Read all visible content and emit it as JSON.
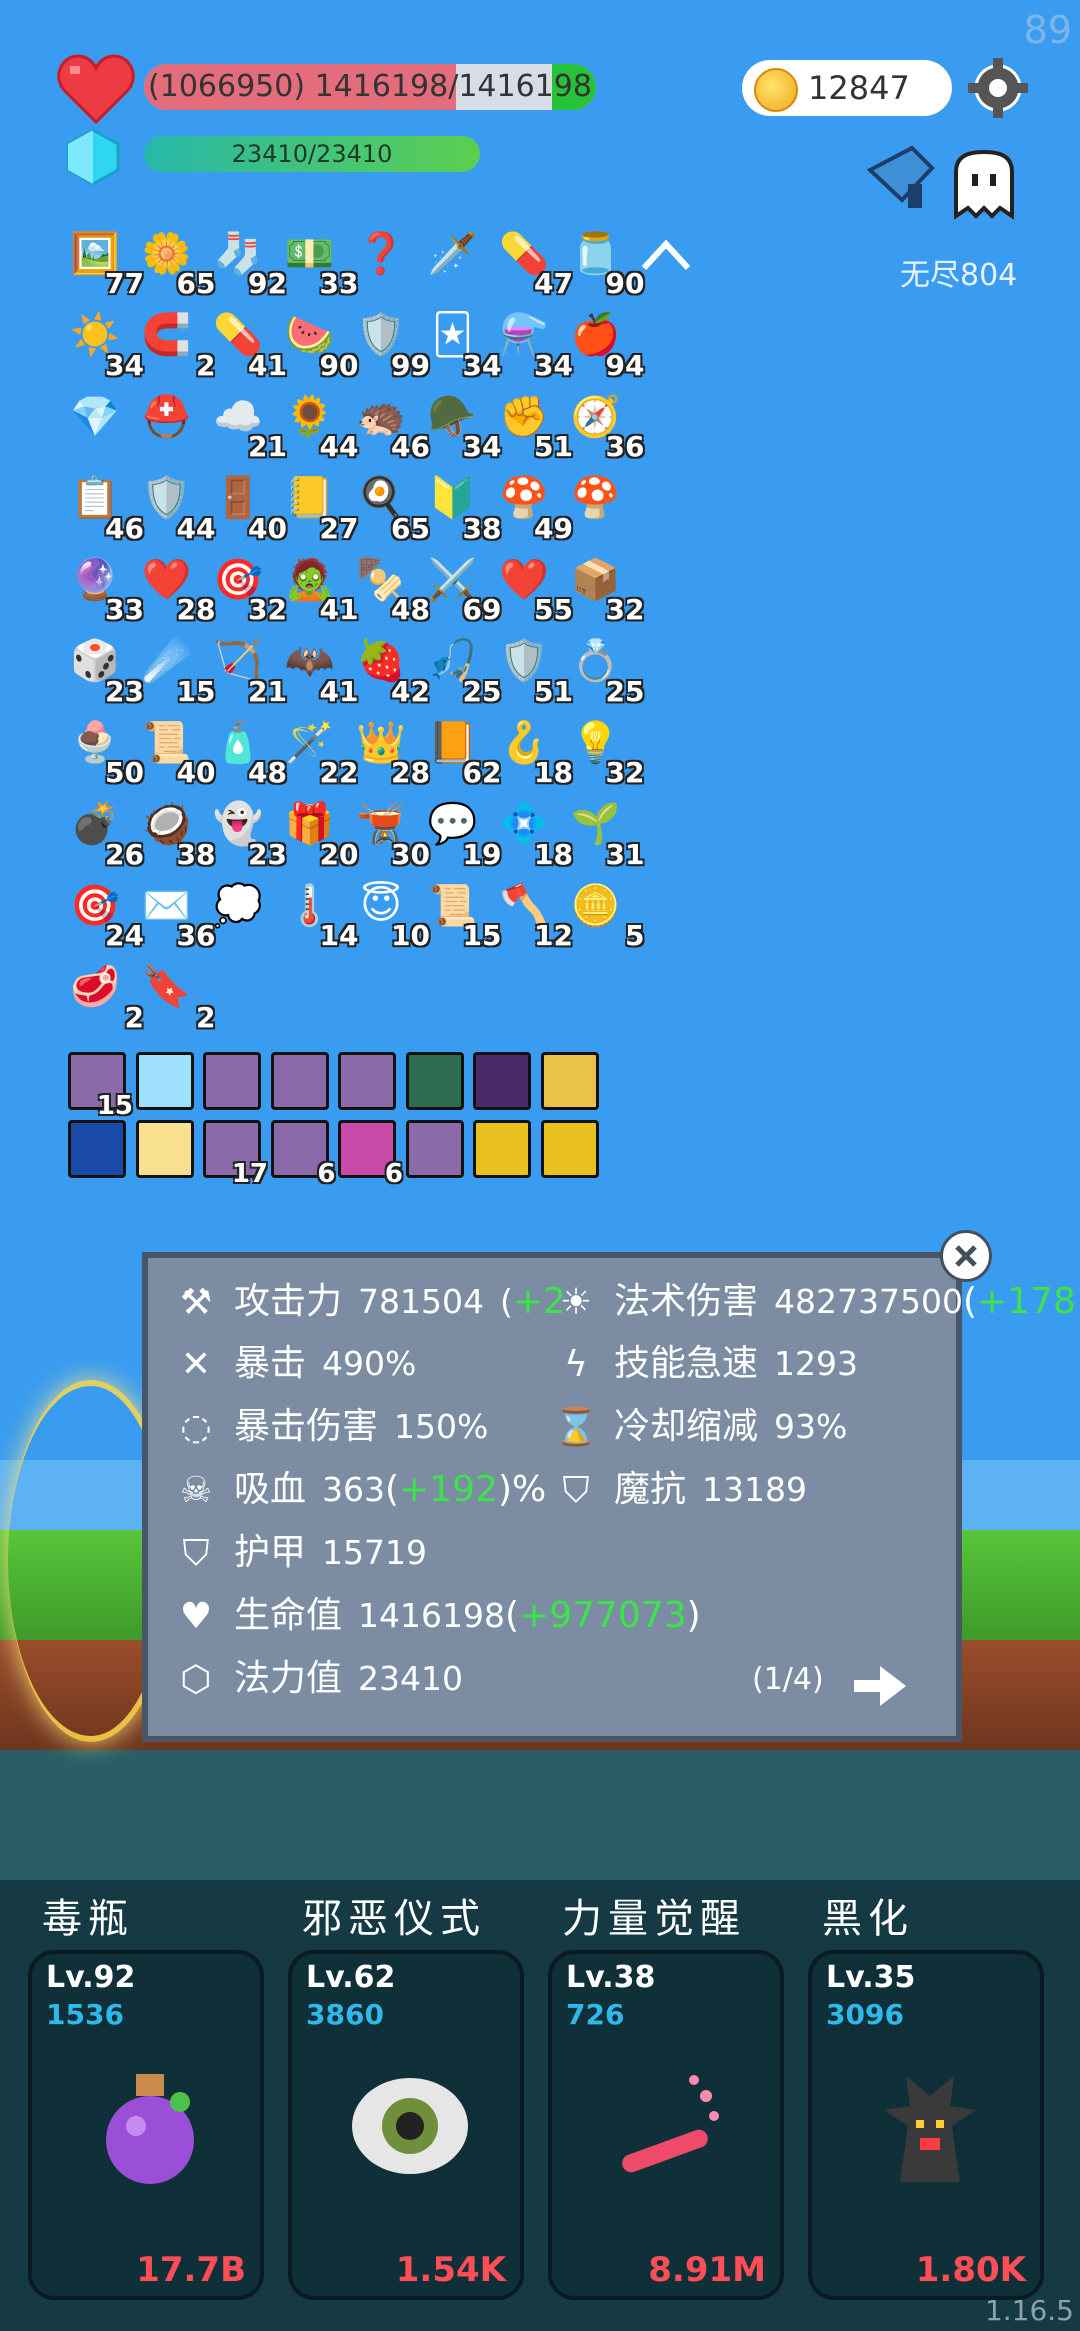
{
  "fps": "89",
  "hp": {
    "text": "(1066950) 1416198/1416198",
    "fill": 0.69
  },
  "mp": {
    "text": "23410/23410"
  },
  "coins": "12847",
  "mode": "无尽804",
  "items": [
    {
      "icon": "🖼️",
      "count": "77"
    },
    {
      "icon": "🌼",
      "count": "65"
    },
    {
      "icon": "🧦",
      "count": "92"
    },
    {
      "icon": "💵",
      "count": "33"
    },
    {
      "icon": "❓",
      "count": ""
    },
    {
      "icon": "🗡️",
      "count": ""
    },
    {
      "icon": "💊",
      "count": "47"
    },
    {
      "icon": "🫙",
      "count": "90"
    },
    {
      "icon": "☀️",
      "count": "34"
    },
    {
      "icon": "🧲",
      "count": "2"
    },
    {
      "icon": "💊",
      "count": "41"
    },
    {
      "icon": "🍉",
      "count": "90"
    },
    {
      "icon": "🛡️",
      "count": "99"
    },
    {
      "icon": "🃏",
      "count": "34"
    },
    {
      "icon": "⚗️",
      "count": "34"
    },
    {
      "icon": "🍎",
      "count": "94"
    },
    {
      "icon": "💎",
      "count": ""
    },
    {
      "icon": "⛑️",
      "count": ""
    },
    {
      "icon": "☁️",
      "count": "21"
    },
    {
      "icon": "🌻",
      "count": "44"
    },
    {
      "icon": "🦔",
      "count": "46"
    },
    {
      "icon": "🪖",
      "count": "34"
    },
    {
      "icon": "✊",
      "count": "51"
    },
    {
      "icon": "🧭",
      "count": "36"
    },
    {
      "icon": "📋",
      "count": "46"
    },
    {
      "icon": "🛡️",
      "count": "44"
    },
    {
      "icon": "🚪",
      "count": "40"
    },
    {
      "icon": "📒",
      "count": "27"
    },
    {
      "icon": "🍳",
      "count": "65"
    },
    {
      "icon": "🔰",
      "count": "38"
    },
    {
      "icon": "🍄",
      "count": "49"
    },
    {
      "icon": "🍄",
      "count": ""
    },
    {
      "icon": "🔮",
      "count": "33"
    },
    {
      "icon": "❤️",
      "count": "28"
    },
    {
      "icon": "🎯",
      "count": "32"
    },
    {
      "icon": "🧟",
      "count": "41"
    },
    {
      "icon": "🍢",
      "count": "48"
    },
    {
      "icon": "⚔️",
      "count": "69"
    },
    {
      "icon": "❤️",
      "count": "55"
    },
    {
      "icon": "📦",
      "count": "32"
    },
    {
      "icon": "🎲",
      "count": "23"
    },
    {
      "icon": "☄️",
      "count": "15"
    },
    {
      "icon": "🏹",
      "count": "21"
    },
    {
      "icon": "🦇",
      "count": "41"
    },
    {
      "icon": "🍓",
      "count": "42"
    },
    {
      "icon": "🎣",
      "count": "25"
    },
    {
      "icon": "🛡️",
      "count": "51"
    },
    {
      "icon": "💍",
      "count": "25"
    },
    {
      "icon": "🍨",
      "count": "50"
    },
    {
      "icon": "📜",
      "count": "40"
    },
    {
      "icon": "🧴",
      "count": "48"
    },
    {
      "icon": "🪄",
      "count": "22"
    },
    {
      "icon": "👑",
      "count": "28"
    },
    {
      "icon": "📙",
      "count": "62"
    },
    {
      "icon": "🪝",
      "count": "18"
    },
    {
      "icon": "💡",
      "count": "32"
    },
    {
      "icon": "💣",
      "count": "26"
    },
    {
      "icon": "🥥",
      "count": "38"
    },
    {
      "icon": "👻",
      "count": "23"
    },
    {
      "icon": "🎁",
      "count": "20"
    },
    {
      "icon": "🫕",
      "count": "30"
    },
    {
      "icon": "💬",
      "count": "19"
    },
    {
      "icon": "💠",
      "count": "18"
    },
    {
      "icon": "🌱",
      "count": "31"
    },
    {
      "icon": "🎯",
      "count": "24"
    },
    {
      "icon": "✉️",
      "count": "36"
    },
    {
      "icon": "💭",
      "count": ""
    },
    {
      "icon": "🌡️",
      "count": "14"
    },
    {
      "icon": "😇",
      "count": "10"
    },
    {
      "icon": "📜",
      "count": "15"
    },
    {
      "icon": "🪓",
      "count": "12"
    },
    {
      "icon": "🪙",
      "count": "5"
    },
    {
      "icon": "🥩",
      "count": "2"
    },
    {
      "icon": "🔖",
      "count": "2"
    }
  ],
  "runes": [
    {
      "color": "#8a6aa8",
      "count": "15"
    },
    {
      "color": "#9fe0ff",
      "count": ""
    },
    {
      "color": "#8a6aa8",
      "count": ""
    },
    {
      "color": "#8a6aa8",
      "count": ""
    },
    {
      "color": "#8a6aa8",
      "count": ""
    },
    {
      "color": "#2f6a52",
      "count": ""
    },
    {
      "color": "#4a2a6a",
      "count": ""
    },
    {
      "color": "#e8c34a",
      "count": ""
    },
    {
      "color": "#1a4aa8",
      "count": ""
    },
    {
      "color": "#f8e090",
      "count": ""
    },
    {
      "color": "#8a6aa8",
      "count": "17"
    },
    {
      "color": "#8a6aa8",
      "count": "6"
    },
    {
      "color": "#c84aa8",
      "count": "6"
    },
    {
      "color": "#8a6aa8",
      "count": ""
    },
    {
      "color": "#e8c020",
      "count": ""
    },
    {
      "color": "#e8c020",
      "count": ""
    }
  ],
  "stats": {
    "attack": {
      "label": "攻击力",
      "value": "781504",
      "plus": "+2"
    },
    "magic": {
      "label": "法术伤害",
      "value": "482737500",
      "plus": "+178"
    },
    "crit": {
      "label": "暴击",
      "value": "490%"
    },
    "haste": {
      "label": "技能急速",
      "value": "1293"
    },
    "critdmg": {
      "label": "暴击伤害",
      "value": "150%"
    },
    "cdr": {
      "label": "冷却缩减",
      "value": "93%"
    },
    "lifesteal": {
      "label": "吸血",
      "value": "363",
      "plus": "+192",
      "suffix": "%"
    },
    "mres": {
      "label": "魔抗",
      "value": "13189"
    },
    "armor": {
      "label": "护甲",
      "value": "15719"
    },
    "life": {
      "label": "生命值",
      "value": "1416198",
      "plus": "+977073"
    },
    "mana": {
      "label": "法力值",
      "value": "23410"
    },
    "page": "(1/4)"
  },
  "skills": [
    {
      "name": "毒瓶",
      "level": "Lv.92",
      "num": "1536",
      "cost": "17.7B"
    },
    {
      "name": "邪恶仪式",
      "level": "Lv.62",
      "num": "3860",
      "cost": "1.54K"
    },
    {
      "name": "力量觉醒",
      "level": "Lv.38",
      "num": "726",
      "cost": "8.91M"
    },
    {
      "name": "黑化",
      "level": "Lv.35",
      "num": "3096",
      "cost": "1.80K"
    }
  ],
  "version": "1.16.5",
  "colors": {
    "plus": "#3ce34a",
    "cost": "#ff4e56",
    "num": "#2fb8ea",
    "hp": "#e46d7b"
  }
}
